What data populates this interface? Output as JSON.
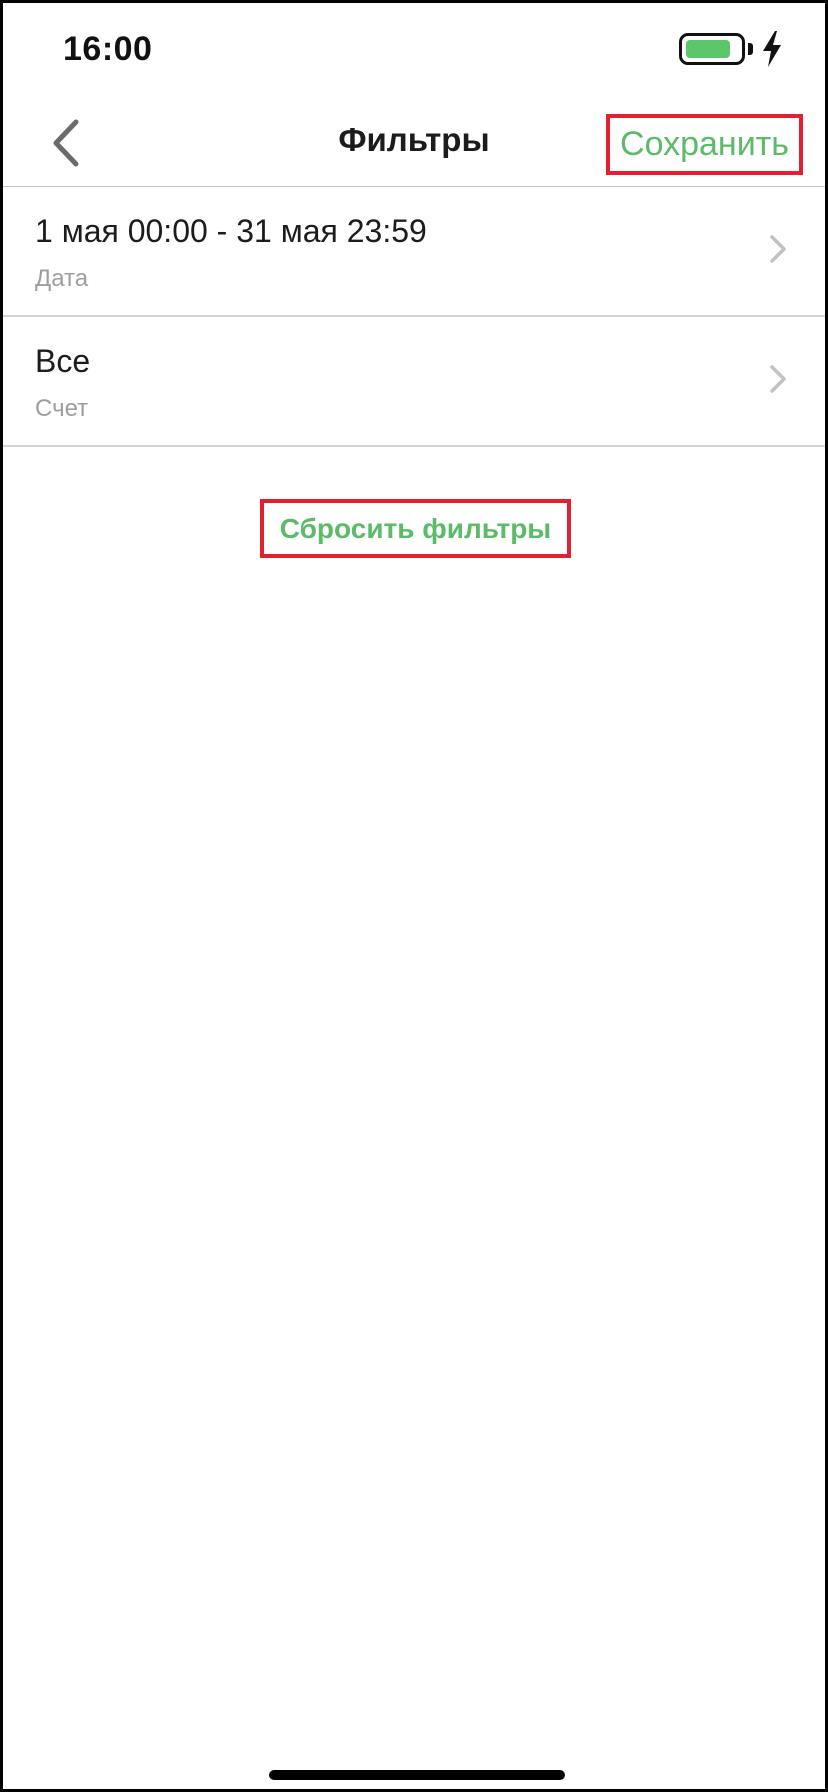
{
  "status_bar": {
    "time": "16:00",
    "battery_icon": "battery-charging-icon",
    "battery_level": 0.85,
    "battery_color": "#5cc66a"
  },
  "nav": {
    "back_icon": "chevron-left-icon",
    "title": "Фильтры",
    "save_label": "Сохранить"
  },
  "filters": [
    {
      "value": "1 мая 00:00 - 31 мая 23:59",
      "caption": "Дата",
      "icon": "chevron-right-icon"
    },
    {
      "value": "Все",
      "caption": "Счет",
      "icon": "chevron-right-icon"
    }
  ],
  "reset_label": "Сбросить фильтры",
  "colors": {
    "accent": "#5cbb68",
    "highlight_border": "#e3202f",
    "caption": "#9e9e9e",
    "divider": "#d4d4d4"
  }
}
